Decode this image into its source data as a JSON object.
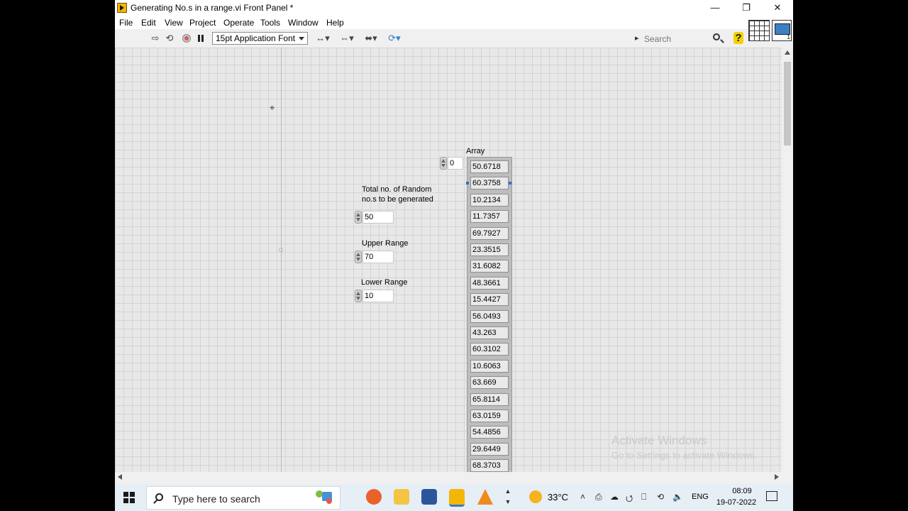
{
  "window": {
    "title": "Generating No.s in a range.vi Front Panel *",
    "minimize_glyph": "—",
    "restore_glyph": "❐",
    "close_glyph": "✕"
  },
  "menu": [
    "File",
    "Edit",
    "View",
    "Project",
    "Operate",
    "Tools",
    "Window",
    "Help"
  ],
  "toolbar": {
    "run_glyph": "⇨",
    "run_continuously_glyph": "⟲",
    "font_label": "15pt Application Font",
    "align_glyph": "↔▾",
    "distribute_glyph": "⇔▾",
    "resize_glyph": "⬌▾",
    "reorder_glyph": "⟳▾",
    "search_placeholder": "Search",
    "help_glyph": "?"
  },
  "panel": {
    "cursor_glyph": "⌖",
    "controls": [
      {
        "label": "Total no. of Random no.s to be generated",
        "value": "50"
      },
      {
        "label": "Upper Range",
        "value": "70"
      },
      {
        "label": "Lower Range",
        "value": "10"
      }
    ],
    "array": {
      "label": "Array",
      "index": "0",
      "values": [
        "50.6718",
        "60.3758",
        "10.2134",
        "11.7357",
        "69.7927",
        "23.3515",
        "31.6082",
        "48.3661",
        "15.4427",
        "56.0493",
        "43.263",
        "60.3102",
        "10.6063",
        "63.669",
        "65.8114",
        "63.0159",
        "54.4856",
        "29.6449",
        "68.3703"
      ]
    },
    "watermark": {
      "line1": "Activate Windows",
      "line2": "Go to Settings to activate Windows."
    }
  },
  "taskbar": {
    "search_placeholder": "Type here to search",
    "apps": [
      {
        "name": "firefox",
        "color": "#e8622a"
      },
      {
        "name": "file-explorer",
        "color": "#f4c542"
      },
      {
        "name": "word",
        "color": "#2b579a"
      },
      {
        "name": "labview",
        "color": "#f2b705"
      },
      {
        "name": "vlc",
        "color": "#f08a1c"
      }
    ],
    "updown_glyph": "▲\n▼",
    "temperature": "33°C",
    "tray_glyphs": [
      "˄",
      "⎙",
      "☁",
      "⭯",
      "⎕",
      "⟲",
      "🔈"
    ],
    "language": "ENG",
    "time": "08:09",
    "date": "19-07-2022"
  }
}
